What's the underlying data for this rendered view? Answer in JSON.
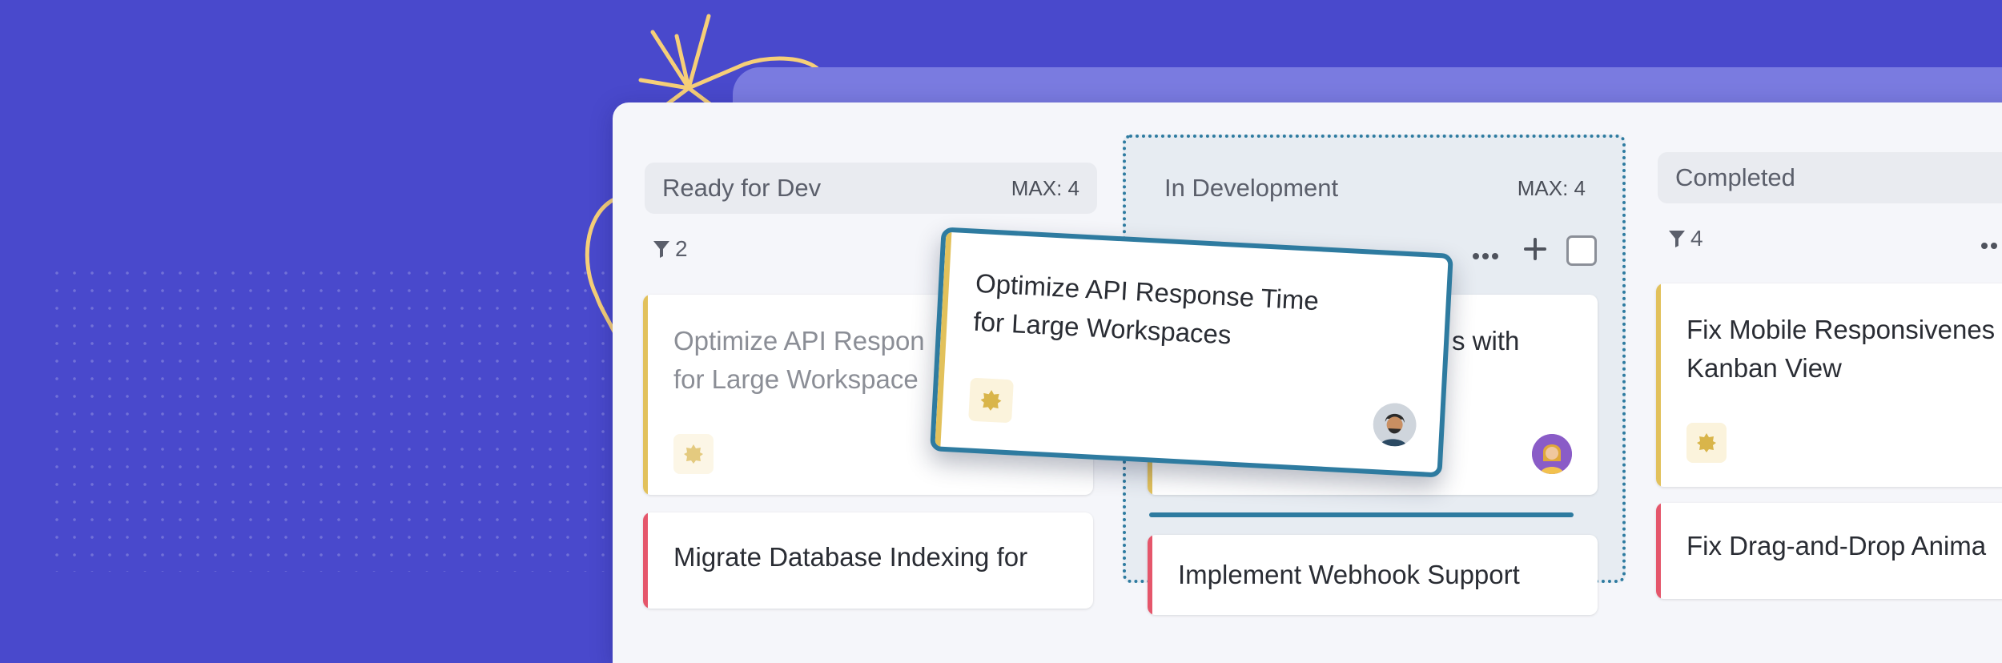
{
  "board": {
    "columns": [
      {
        "title": "Ready for Dev",
        "max": "MAX: 4",
        "filter_count": "2",
        "cards": [
          {
            "title_lines": [
              "Optimize API Respon",
              "for Large Workspace"
            ],
            "stripe": "#e2c15b"
          },
          {
            "title_lines": [
              "Migrate Database Indexing for"
            ],
            "stripe": "#e5566b"
          }
        ]
      },
      {
        "title": "In Development",
        "max": "MAX: 4",
        "cards": [
          {
            "title_lines": [
              "s with"
            ],
            "stripe": "#e2c15b"
          },
          {
            "title_lines": [
              "Implement Webhook Support"
            ],
            "stripe": "#e5566b"
          }
        ]
      },
      {
        "title": "Completed",
        "filter_count": "4",
        "cards": [
          {
            "title_lines": [
              "Fix Mobile Responsivenes",
              "Kanban View"
            ],
            "stripe": "#e2c15b"
          },
          {
            "title_lines": [
              "Fix Drag-and-Drop Anima"
            ],
            "stripe": "#e5566b"
          }
        ]
      }
    ]
  },
  "dragging_card": {
    "title_lines": [
      "Optimize API Response Time",
      "for Large Workspaces"
    ]
  },
  "toolbar": {
    "more_icon": "more-horizontal-icon",
    "add_icon": "plus-icon",
    "select_icon": "checkbox-icon"
  },
  "colors": {
    "background": "#4949cc",
    "accent": "#2e7ba0",
    "priority_yellow": "#e2c15b",
    "priority_red": "#e5566b"
  }
}
